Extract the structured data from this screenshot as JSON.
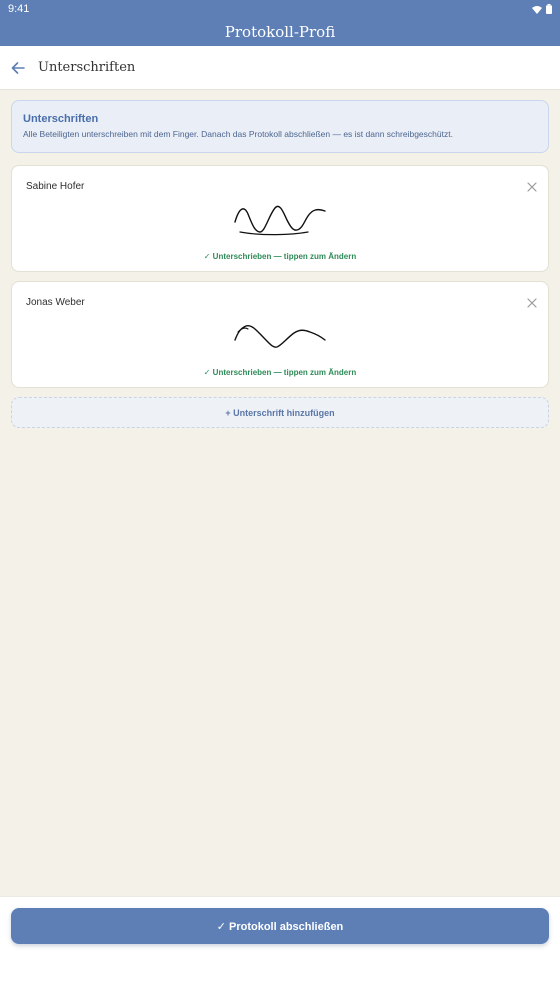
{
  "status_bar": {
    "time": "9:41"
  },
  "app": {
    "title": "Protokoll-Profi"
  },
  "toolbar": {
    "title": "Unterschriften"
  },
  "info": {
    "title": "Unterschriften",
    "text": "Alle Beteiligten unterschreiben mit dem Finger. Danach das Protokoll abschließen — es ist dann schreibgeschützt."
  },
  "signatures": [
    {
      "name": "Sabine Hofer",
      "status": "✓ Unterschrieben — tippen zum Ändern"
    },
    {
      "name": "Jonas Weber",
      "status": "✓ Unterschrieben — tippen zum Ändern"
    }
  ],
  "add_button": {
    "label": "+ Unterschrift hinzufügen"
  },
  "finish_button": {
    "label": "✓ Protokoll abschließen"
  },
  "colors": {
    "accent": "#5d7fb6",
    "background": "#f4f1e8",
    "success": "#2e8b57"
  }
}
